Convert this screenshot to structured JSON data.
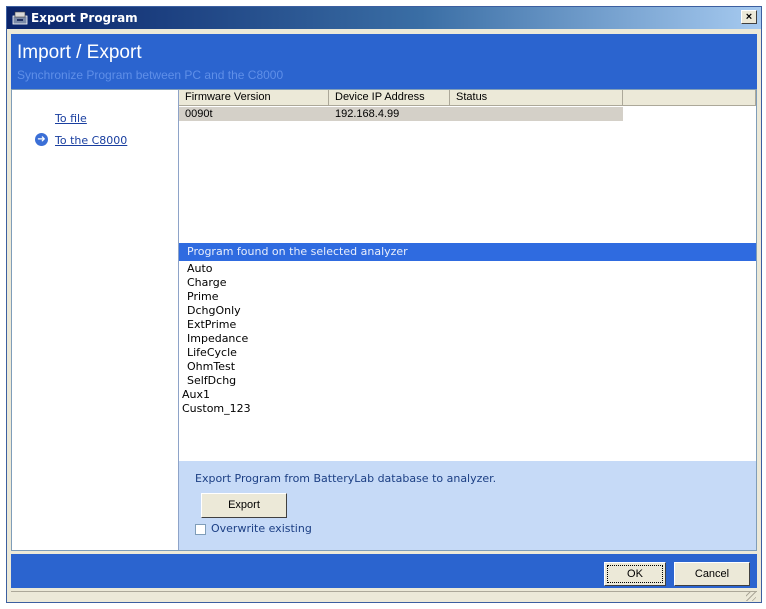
{
  "window": {
    "title": "Export Program",
    "close_glyph": "×"
  },
  "header": {
    "title": "Import / Export",
    "subtitle": "Synchronize Program between PC and the C8000"
  },
  "sidebar": {
    "items": [
      {
        "label": "To file"
      },
      {
        "label": "To the C8000",
        "selected": true,
        "icon": "arrow-right-circle-icon"
      }
    ]
  },
  "device_table": {
    "columns": [
      "Firmware Version",
      "Device IP Address",
      "Status",
      ""
    ],
    "rows": [
      {
        "firmware": "0090t",
        "ip": "192.168.4.99",
        "status": ""
      }
    ]
  },
  "programs": {
    "header": "Program found on the selected analyzer",
    "items": [
      "Auto",
      "Charge",
      "Prime",
      "DchgOnly",
      "ExtPrime",
      "Impedance",
      "LifeCycle",
      "OhmTest",
      "SelfDchg",
      "Aux1",
      "Custom_123"
    ]
  },
  "export_panel": {
    "message": "Export Program from BatteryLab database to analyzer.",
    "export_label": "Export",
    "overwrite_label": "Overwrite existing",
    "overwrite_checked": false
  },
  "footer": {
    "ok_label": "OK",
    "cancel_label": "Cancel"
  },
  "colors": {
    "accent_blue": "#2b64cf",
    "selected_row": "#d4d0c8",
    "panel_blue": "#c6daf7"
  }
}
